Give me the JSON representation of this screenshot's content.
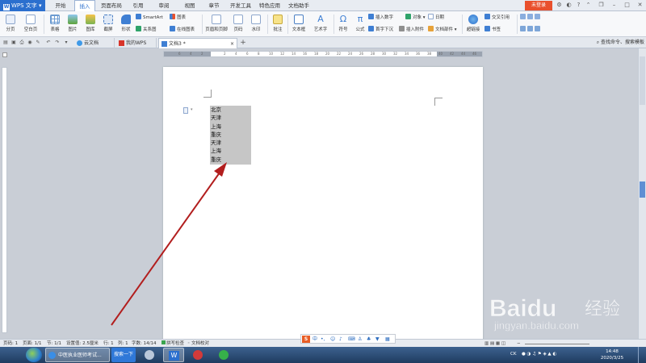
{
  "app": {
    "name": "WPS 文字",
    "login_label": "未登录"
  },
  "ribbon_tabs": [
    "开始",
    "插入",
    "页面布局",
    "引用",
    "审阅",
    "视图",
    "章节",
    "开发工具",
    "特色应用",
    "文档助手"
  ],
  "active_tab": "插入",
  "ribbon": {
    "page_break": "分页",
    "blank_page": "空白页",
    "table": "表格",
    "picture": "图片",
    "gallery": "图库",
    "screenshot": "截屏",
    "shape": "形状",
    "smartart": "SmartArt",
    "chart": "图表",
    "relation_graph": "关系图",
    "online_chart": "在线图表",
    "header_footer": "页眉和页脚",
    "page_number": "页码",
    "watermark": "水印",
    "comment": "批注",
    "textbox": "文本框",
    "wordart": "艺术字",
    "symbol": "符号",
    "formula": "公式",
    "insert_number": "插入数字",
    "object": "对象",
    "drop_cap": "首字下沉",
    "attachment": "插入附件",
    "date": "日期",
    "doc_parts": "文档部件",
    "hyperlink": "超链接",
    "cross_ref": "交叉引用",
    "bookmark": "书签"
  },
  "doc_tabs": [
    "云文档",
    "我的WPS",
    "文档3 *"
  ],
  "search_command": "查找命令、搜索模板",
  "ruler_numbers": [
    "6",
    "4",
    "2",
    "",
    "2",
    "4",
    "6",
    "8",
    "10",
    "12",
    "14",
    "16",
    "18",
    "20",
    "22",
    "24",
    "26",
    "28",
    "30",
    "32",
    "34",
    "36",
    "38",
    "40",
    "42",
    "44",
    "46"
  ],
  "document_lines": [
    "北京",
    "天津",
    "上海",
    "重庆",
    "天津",
    "上海",
    "重庆"
  ],
  "status": {
    "page": "页码: 1",
    "pages": "页面: 1/1",
    "section": "节: 1/1",
    "position": "设置值: 2.5厘米",
    "row": "行: 1",
    "column": "列: 1",
    "words": "字数: 14/14",
    "spell": "拼写检查",
    "proof": "文档校对"
  },
  "taskbar": {
    "browser_item": "中医执业医师考试...",
    "search_button": "搜索一下",
    "lang": "CK",
    "time": "14:48",
    "date": "2020/3/25"
  },
  "watermark": {
    "brand": "Baidu",
    "cn": "经验",
    "url": "jingyan.baidu.com"
  },
  "colors": {
    "accent": "#2b6fce",
    "arrow": "#b21e1e",
    "login": "#e9502d",
    "selection": "#c6c6c6"
  }
}
